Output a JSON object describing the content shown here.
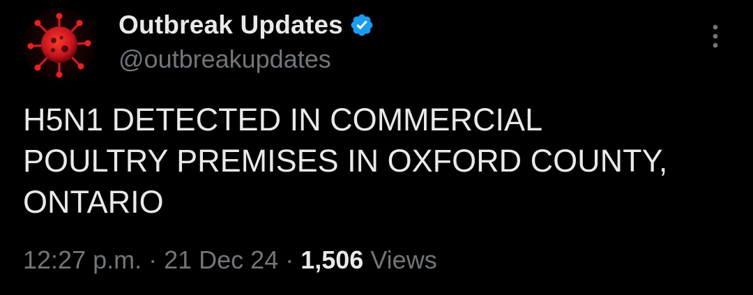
{
  "tweet": {
    "author": {
      "display_name": "Outbreak Updates",
      "handle": "@outbreakupdates",
      "verified": true,
      "avatar_icon": "virus-icon"
    },
    "text": "H5N1 DETECTED IN COMMERCIAL\nPOULTRY PREMISES IN OXFORD COUNTY,\nONTARIO",
    "time": "12:27 p.m.",
    "separator": "·",
    "date": "21 Dec 24",
    "views_count": "1,506",
    "views_label": "Views",
    "more_icon": "more-options-icon"
  },
  "colors": {
    "background": "#000000",
    "primary_text": "#e7e9ea",
    "secondary_text": "#71767b",
    "verified_blue": "#1d9bf0",
    "avatar_red": "#c4141c"
  }
}
